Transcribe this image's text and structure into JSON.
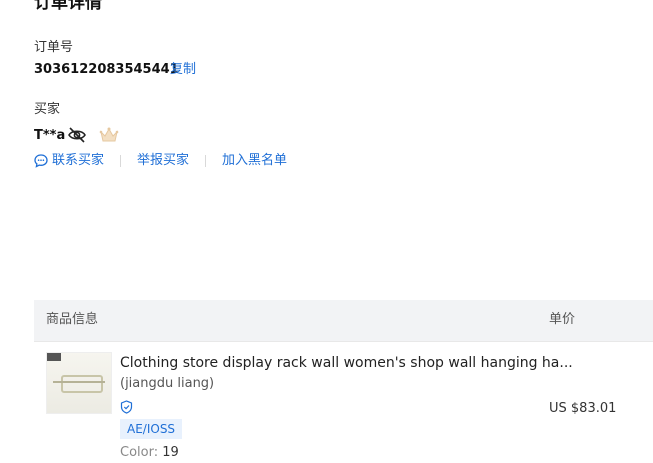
{
  "page": {
    "title": "订单详情"
  },
  "order": {
    "label": "订单号",
    "number": "3036122083545441",
    "copy_label": "复制"
  },
  "buyer": {
    "label": "买家",
    "name": "T**a",
    "actions": {
      "contact": "联系买家",
      "report": "举报买家",
      "blacklist": "加入黑名单"
    }
  },
  "icons": {
    "visibility": "eye-off-icon",
    "vip": "crown-icon",
    "chat": "chat-icon",
    "verified": "shield-check-icon"
  },
  "colors": {
    "accent": "#1f6fd6",
    "header_bg": "#f2f3f5",
    "tag_bg": "#e8f1fd",
    "crown": "#e6c8a0"
  },
  "table": {
    "columns": {
      "product": "商品信息",
      "price": "单价"
    },
    "rows": [
      {
        "title": "Clothing store display rack wall women's shop wall hanging ha...",
        "seller": "(jiangdu liang)",
        "tag": "AE/IOSS",
        "color_key": "Color:",
        "color_value": "19",
        "price": "US $83.01"
      }
    ]
  }
}
